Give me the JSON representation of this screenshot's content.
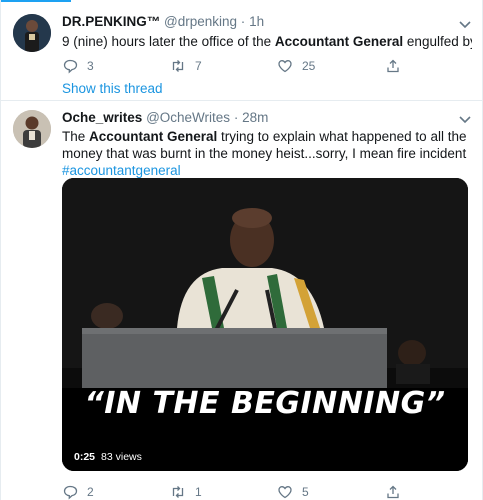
{
  "tweets": [
    {
      "name": "DR.PENKING™",
      "handle": "@drpenking",
      "dot": "·",
      "time": "1h",
      "text_before": "9 (nine) hours later the office of the ",
      "text_bold": "Accountant General",
      "text_after": " engulfed by fire...",
      "replies": "3",
      "retweets": "7",
      "likes": "25",
      "show_thread": "Show this thread"
    },
    {
      "name": "Oche_writes",
      "handle": "@OcheWrites",
      "dot": "·",
      "time": "28m",
      "text_before": "The ",
      "text_bold": "Accountant General",
      "text_after": " trying to explain what happened to all the money that was burnt in the money heist...sorry, I mean fire incident",
      "hashtag": "#accountantgeneral",
      "video_caption": "“IN THE BEGINNING”",
      "video_time": "0:25",
      "video_views": "83 views",
      "replies": "2",
      "retweets": "1",
      "likes": "5"
    }
  ],
  "colors": {
    "accent": "#1da1f2",
    "link": "#1b95e0",
    "secondary_text": "#657786",
    "border": "#e6ecf0"
  },
  "icons": [
    "chevron-down-icon",
    "reply-icon",
    "retweet-icon",
    "like-icon",
    "share-icon"
  ]
}
